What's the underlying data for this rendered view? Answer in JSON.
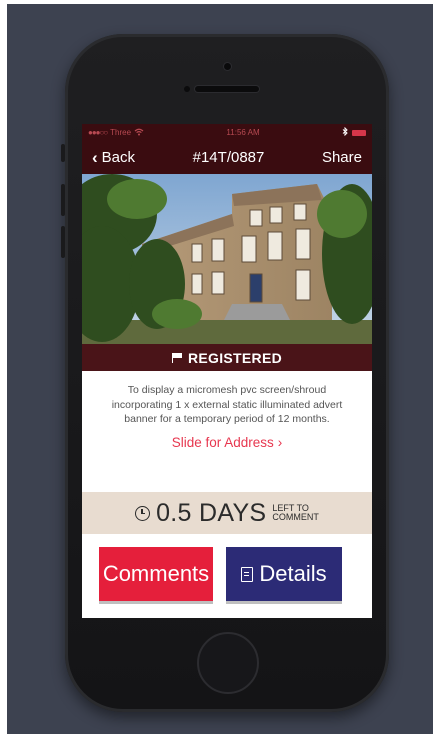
{
  "status_bar": {
    "carrier": "Three",
    "wifi_icon": "wifi-icon",
    "time": "11:56 AM",
    "bluetooth_icon": "bluetooth-icon",
    "battery_icon": "battery-icon"
  },
  "nav": {
    "back_label": "Back",
    "title": "#14T/0887",
    "share_label": "Share"
  },
  "photo": {
    "description_icon": "building-photo"
  },
  "status": {
    "label": "REGISTERED",
    "icon": "flag-icon"
  },
  "application": {
    "description": "To display a micromesh pvc screen/shroud incorporating 1 x external static illuminated advert banner for a temporary period of 12 months.",
    "slide_label": "Slide for Address"
  },
  "countdown": {
    "value": "0.5 DAYS",
    "suffix_line1": "LEFT TO",
    "suffix_line2": "COMMENT"
  },
  "buttons": {
    "comments_label": "Comments",
    "details_label": "Details"
  },
  "colors": {
    "bar": "#3a0c10",
    "strip": "#4a1418",
    "accent_red": "#e51f3b",
    "accent_navy": "#2c2b76",
    "countdown_bg": "#e8dcd0",
    "stage_bg": "#3d4250"
  }
}
